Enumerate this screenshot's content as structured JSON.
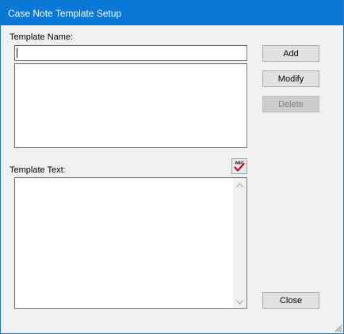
{
  "window": {
    "title": "Case Note Template Setup"
  },
  "template_name": {
    "label": "Template Name:",
    "value": ""
  },
  "template_list": {
    "items": []
  },
  "template_text": {
    "label": "Template Text:",
    "value": ""
  },
  "buttons": {
    "add": "Add",
    "modify": "Modify",
    "delete": "Delete",
    "close": "Close"
  },
  "spell_check": {
    "icon": "spell-check-icon",
    "glyph_text": "ABC"
  },
  "colors": {
    "titlebar": "#0a78d7",
    "window_bg": "#f0f0f0",
    "check_mark": "#c0142a"
  }
}
